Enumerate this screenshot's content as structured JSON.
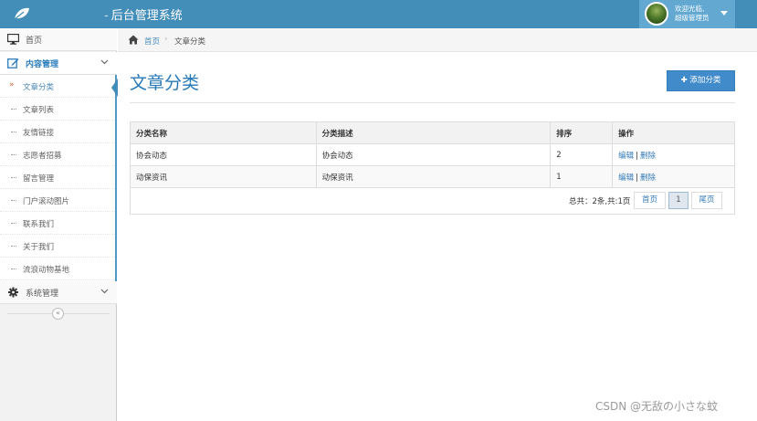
{
  "header": {
    "title": "后台管理系统",
    "welcome": "欢迎光临,",
    "role": "超级管理员"
  },
  "sidebar": {
    "items": [
      {
        "label": "首页",
        "icon": "desktop-icon"
      },
      {
        "label": "内容管理",
        "icon": "edit-icon",
        "expanded": true
      },
      {
        "label": "系统管理",
        "icon": "gear-icon"
      }
    ],
    "sub_items": [
      {
        "label": "文章分类",
        "active": true
      },
      {
        "label": "文章列表"
      },
      {
        "label": "友情链接"
      },
      {
        "label": "志愿者招募"
      },
      {
        "label": "留言管理"
      },
      {
        "label": "门户滚动图片"
      },
      {
        "label": "联系我们"
      },
      {
        "label": "关于我们"
      },
      {
        "label": "流浪动物基地"
      }
    ],
    "collapse_symbol": "«"
  },
  "breadcrumb": {
    "home": "首页",
    "current": "文章分类"
  },
  "main": {
    "title": "文章分类",
    "add_button": "添加分类",
    "table": {
      "headers": [
        "分类名称",
        "分类描述",
        "排序",
        "操作"
      ],
      "rows": [
        {
          "name": "协会动态",
          "desc": "协会动态",
          "order": "2",
          "edit": "编辑",
          "delete": "删除"
        },
        {
          "name": "动保资讯",
          "desc": "动保资讯",
          "order": "1",
          "edit": "编辑",
          "delete": "删除"
        }
      ]
    },
    "pager": {
      "total": "总共：2条,共:1页",
      "first": "首页",
      "current": "1",
      "last": "尾页"
    }
  },
  "watermark": "CSDN @无敌の小さな蚊",
  "colors": {
    "header": "#438eb9",
    "accent": "#2679b5",
    "button": "#428bca"
  }
}
